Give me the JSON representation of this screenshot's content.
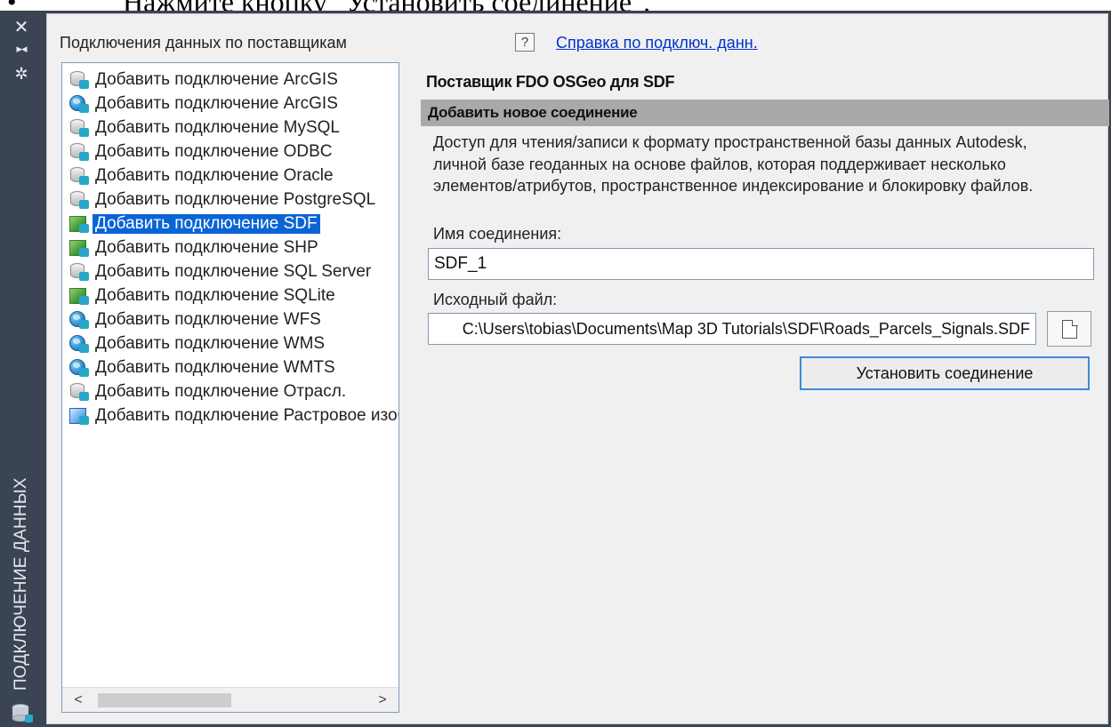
{
  "document": {
    "bullet": "•",
    "instruction": "Нажмите кнопку \"Установить соединение\"."
  },
  "palette": {
    "title": "ПОДКЛЮЧЕНИЕ ДАННЫХ",
    "close_glyph": "✕",
    "pin_glyph": "▸◂",
    "settings_glyph": "✲"
  },
  "panel": {
    "providers_label": "Подключения данных по поставщикам",
    "help_glyph": "?",
    "help_link": "Справка по подключ. данн.",
    "providers": [
      {
        "label": "Добавить подключение ArcGIS",
        "icon": "database-icon"
      },
      {
        "label": "Добавить подключение ArcGIS",
        "icon": "globe-icon"
      },
      {
        "label": "Добавить подключение MySQL",
        "icon": "database-icon"
      },
      {
        "label": "Добавить подключение ODBC",
        "icon": "database-icon"
      },
      {
        "label": "Добавить подключение Oracle",
        "icon": "database-icon"
      },
      {
        "label": "Добавить подключение PostgreSQL",
        "icon": "database-icon"
      },
      {
        "label": "Добавить подключение SDF",
        "icon": "map-file-icon",
        "selected": true
      },
      {
        "label": "Добавить подключение SHP",
        "icon": "map-file-icon"
      },
      {
        "label": "Добавить подключение SQL Server",
        "icon": "database-icon"
      },
      {
        "label": "Добавить подключение SQLite",
        "icon": "map-file-icon"
      },
      {
        "label": "Добавить подключение WFS",
        "icon": "globe-icon"
      },
      {
        "label": "Добавить подключение WMS",
        "icon": "globe-icon"
      },
      {
        "label": "Добавить подключение WMTS",
        "icon": "globe-icon"
      },
      {
        "label": "Добавить подключение Отрасл.",
        "icon": "database-icon"
      },
      {
        "label": "Добавить подключение Растровое изображение",
        "icon": "raster-icon"
      }
    ],
    "scroll_left": "<",
    "scroll_right": ">"
  },
  "detail": {
    "provider_title": "Поставщик FDO OSGeo для SDF",
    "section_header": "Добавить новое соединение",
    "description": "Доступ для чтения/записи к формату пространственной базы данных Autodesk, личной базе геоданных на основе файлов, которая поддерживает несколько элементов/атрибутов, пространственное индексирование и блокировку файлов.",
    "connection_name_label": "Имя соединения:",
    "connection_name_value": "SDF_1",
    "source_file_label": "Исходный файл:",
    "source_file_value": "C:\\Users\\tobias\\Documents\\Map 3D Tutorials\\SDF\\Roads_Parcels_Signals.SDF",
    "connect_button": "Установить соединение"
  }
}
